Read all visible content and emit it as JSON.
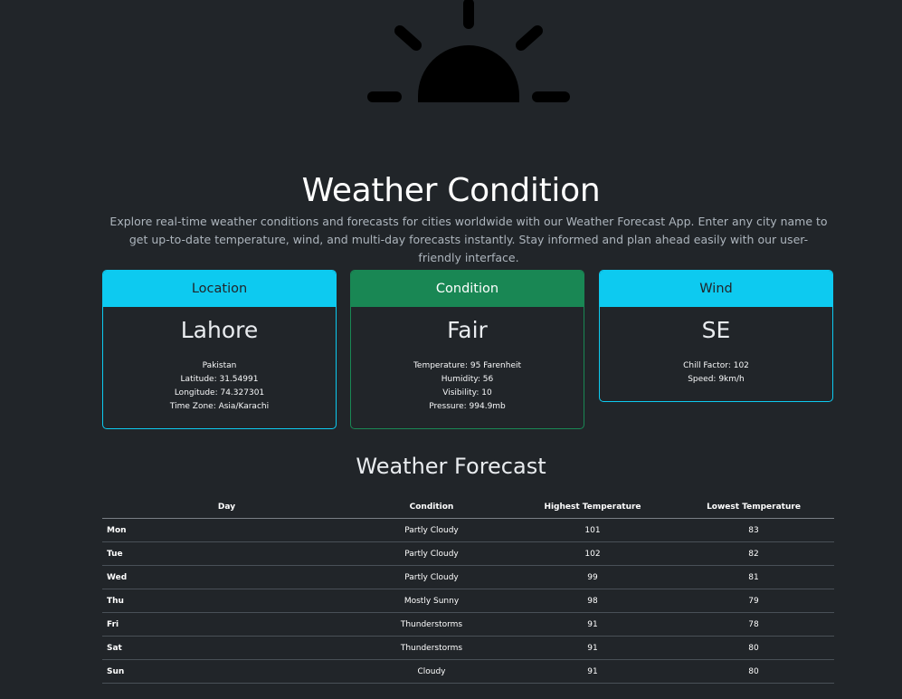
{
  "header": {
    "icon": "sunrise-icon",
    "title": "Weather Condition",
    "description": "Explore real-time weather conditions and forecasts for cities worldwide with our Weather Forecast App. Enter any city name to get up-to-date temperature, wind, and multi-day forecasts instantly. Stay informed and plan ahead easily with our user-friendly interface."
  },
  "location": {
    "header": "Location",
    "city": "Lahore",
    "country": "Pakistan",
    "latitude": "Latitude: 31.54991",
    "longitude": "Longitude: 74.327301",
    "timezone": "Time Zone: Asia/Karachi"
  },
  "condition": {
    "header": "Condition",
    "summary": "Fair",
    "temperature": "Temperature: 95 Farenheit",
    "humidity": "Humidity: 56",
    "visibility": "Visibility: 10",
    "pressure": "Pressure: 994.9mb"
  },
  "wind": {
    "header": "Wind",
    "direction": "SE",
    "chill": "Chill Factor: 102",
    "speed": "Speed: 9km/h"
  },
  "forecast": {
    "title": "Weather Forecast",
    "columns": [
      "Day",
      "Condition",
      "Highest Temperature",
      "Lowest Temperature"
    ],
    "rows": [
      {
        "day": "Mon",
        "condition": "Partly Cloudy",
        "high": "101",
        "low": "83"
      },
      {
        "day": "Tue",
        "condition": "Partly Cloudy",
        "high": "102",
        "low": "82"
      },
      {
        "day": "Wed",
        "condition": "Partly Cloudy",
        "high": "99",
        "low": "81"
      },
      {
        "day": "Thu",
        "condition": "Mostly Sunny",
        "high": "98",
        "low": "79"
      },
      {
        "day": "Fri",
        "condition": "Thunderstorms",
        "high": "91",
        "low": "78"
      },
      {
        "day": "Sat",
        "condition": "Thunderstorms",
        "high": "91",
        "low": "80"
      },
      {
        "day": "Sun",
        "condition": "Cloudy",
        "high": "91",
        "low": "80"
      }
    ]
  },
  "colors": {
    "background": "#212529",
    "info": "#0dcaf0",
    "success": "#198754"
  }
}
